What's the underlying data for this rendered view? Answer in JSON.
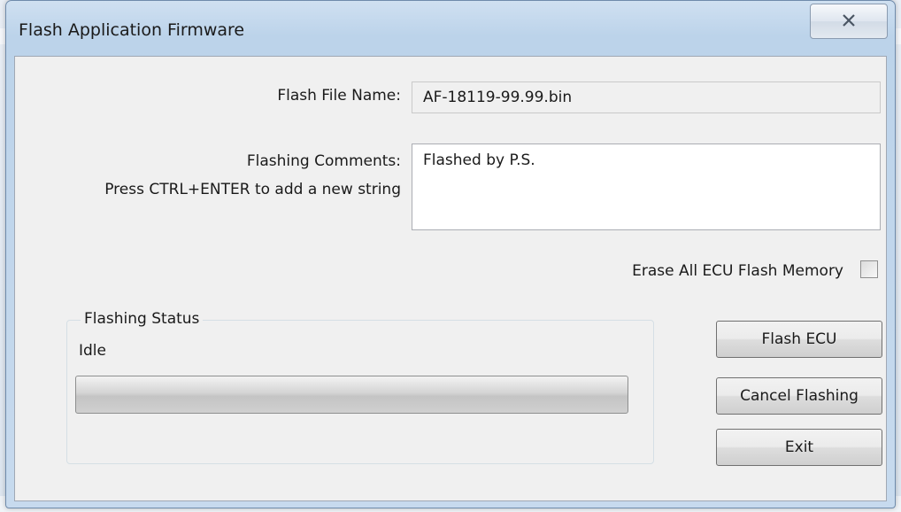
{
  "window": {
    "title": "Flash Application Firmware",
    "close_icon": "close-x-icon"
  },
  "form": {
    "flash_file_label": "Flash File Name:",
    "flash_file_value": "AF-18119-99.99.bin",
    "comments_label": "Flashing Comments:",
    "comments_hint": "Press CTRL+ENTER to add a new string",
    "comments_value": "Flashed by P.S.",
    "erase_label": "Erase All ECU Flash Memory",
    "erase_checked": false
  },
  "status": {
    "group_title": "Flashing Status",
    "text": "Idle",
    "progress": 0
  },
  "buttons": {
    "flash": "Flash ECU",
    "cancel": "Cancel Flashing",
    "exit": "Exit"
  }
}
